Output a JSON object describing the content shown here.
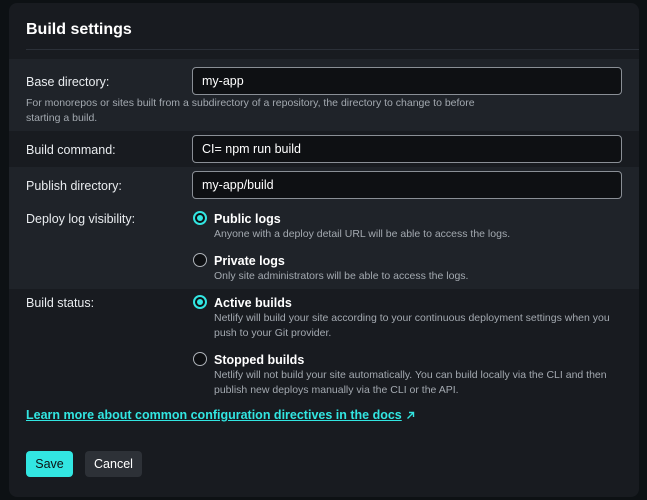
{
  "title": "Build settings",
  "base_directory": {
    "label": "Base directory:",
    "value": "my-app",
    "help": "For monorepos or sites built from a subdirectory of a repository, the directory to change to before starting a build."
  },
  "build_command": {
    "label": "Build command:",
    "value": "CI= npm run build"
  },
  "publish_directory": {
    "label": "Publish directory:",
    "value": "my-app/build"
  },
  "deploy_log": {
    "label": "Deploy log visibility:",
    "options": [
      {
        "label": "Public logs",
        "desc": "Anyone with a deploy detail URL will be able to access the logs.",
        "checked": true
      },
      {
        "label": "Private logs",
        "desc": "Only site administrators will be able to access the logs.",
        "checked": false
      }
    ]
  },
  "build_status": {
    "label": "Build status:",
    "options": [
      {
        "label": "Active builds",
        "desc": "Netlify will build your site according to your continuous deployment settings when you push to your Git provider.",
        "checked": true
      },
      {
        "label": "Stopped builds",
        "desc": "Netlify will not build your site automatically. You can build locally via the CLI and then publish new deploys manually via the CLI or the API.",
        "checked": false
      }
    ]
  },
  "docs_link": {
    "text": "Learn more about common configuration directives in the docs",
    "icon": "external-link-icon"
  },
  "buttons": {
    "save": "Save",
    "cancel": "Cancel"
  },
  "colors": {
    "accent": "#32e6e2",
    "background": "#181b20",
    "band": "#1f2329"
  }
}
